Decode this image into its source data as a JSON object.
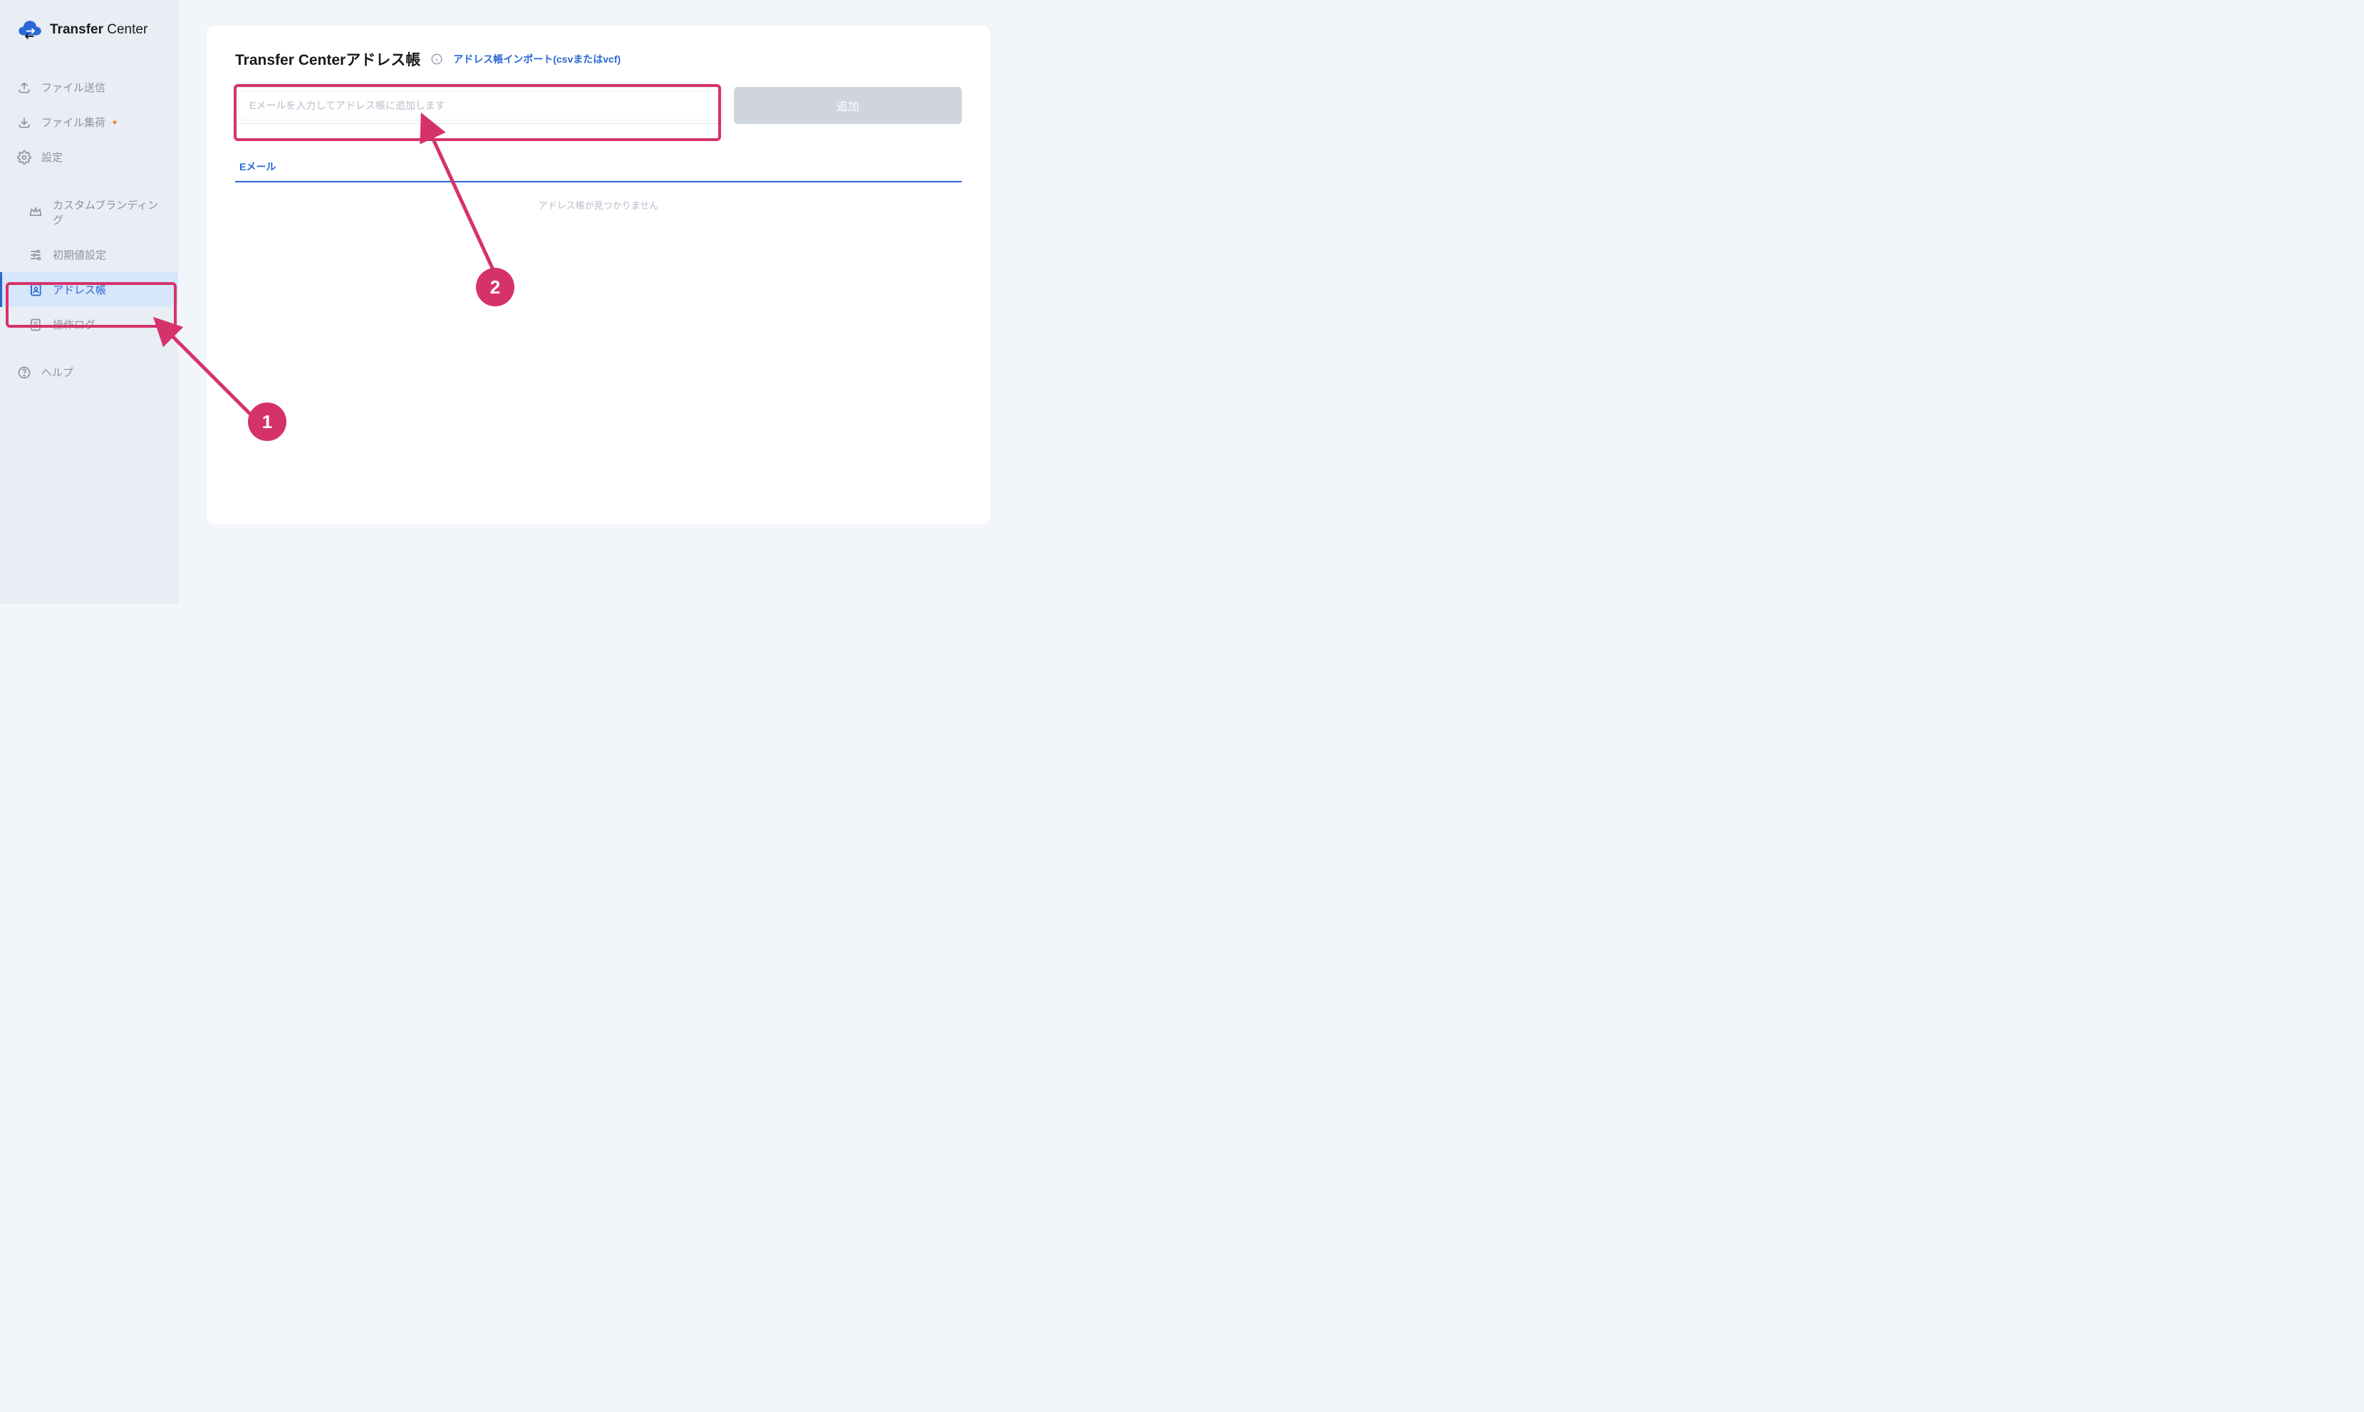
{
  "brand": {
    "name_bold": "Transfer",
    "name_light": "Center"
  },
  "sidebar": {
    "items": [
      {
        "label": "ファイル送信"
      },
      {
        "label": "ファイル集荷"
      },
      {
        "label": "設定"
      },
      {
        "label": "カスタムブランディング"
      },
      {
        "label": "初期値設定"
      },
      {
        "label": "アドレス帳"
      },
      {
        "label": "操作ログ"
      },
      {
        "label": "ヘルプ"
      }
    ]
  },
  "panel": {
    "title": "Transfer Centerアドレス帳",
    "import_link": "アドレス帳インポート(csvまたはvcf)",
    "input_placeholder": "Eメールを入力してアドレス帳に追加します",
    "add_button": "追加",
    "table_header_email": "Eメール",
    "empty_message": "アドレス帳が見つかりません"
  },
  "annotations": {
    "step1": "1",
    "step2": "2"
  }
}
